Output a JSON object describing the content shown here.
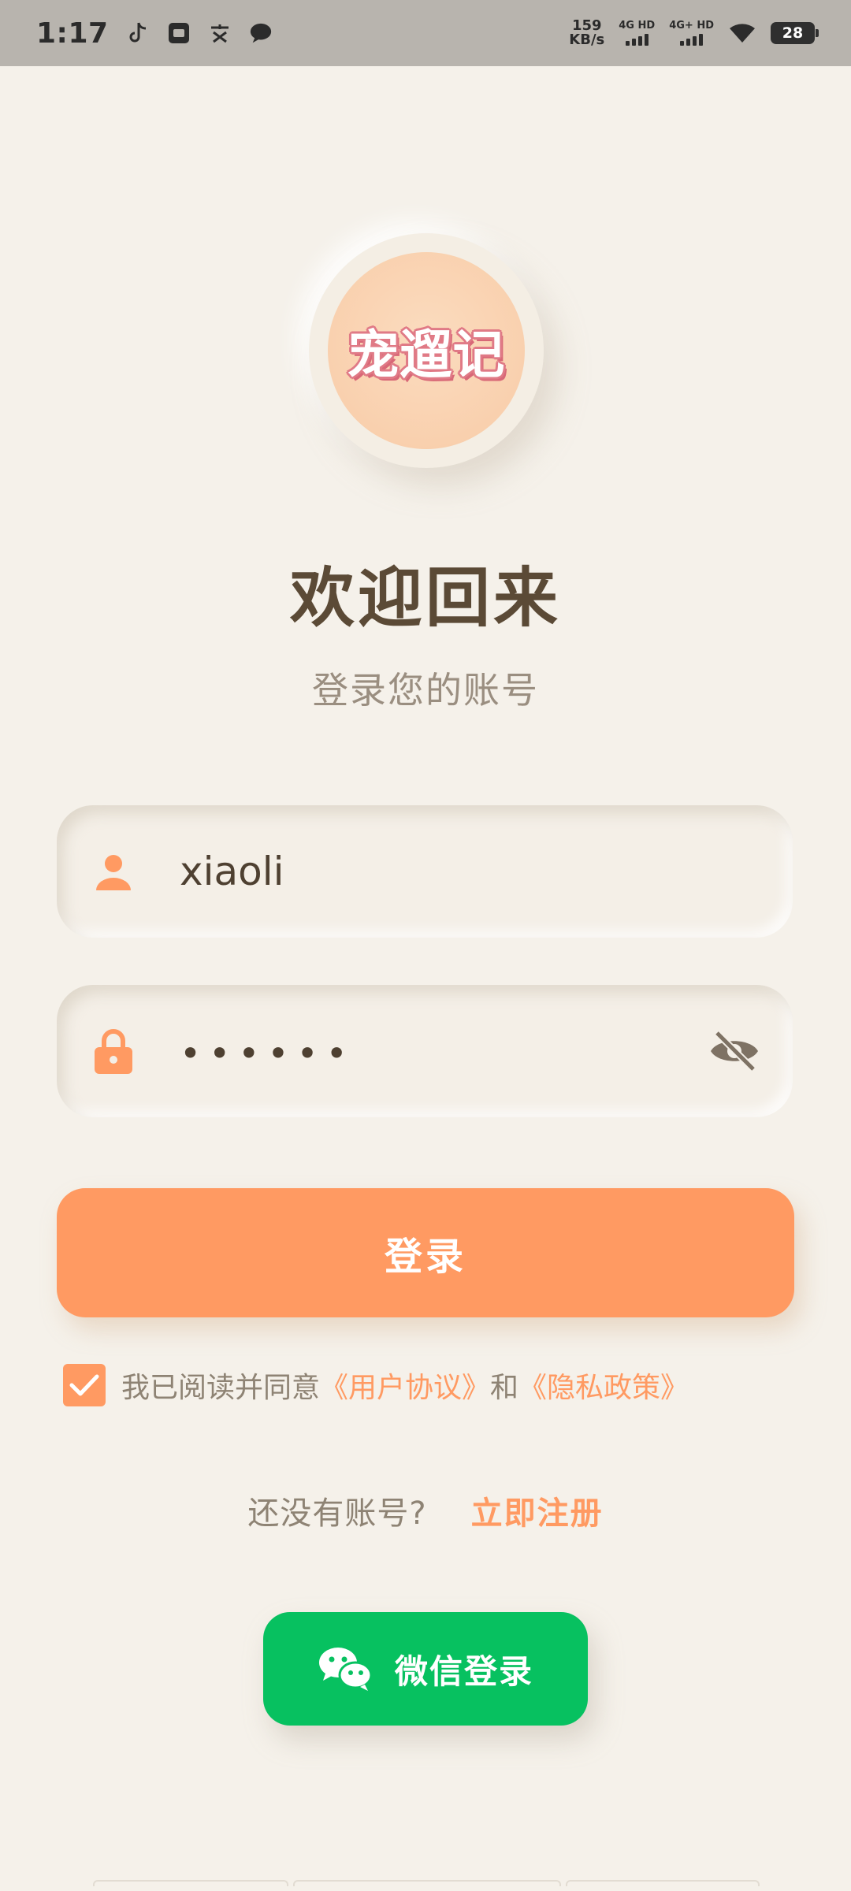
{
  "status_bar": {
    "time": "1:17",
    "speed_value": "159",
    "speed_unit": "KB/s",
    "net1": "4G HD",
    "net2": "4G+ HD",
    "battery": "28",
    "notification_icons": [
      "tiktok-icon",
      "box-icon",
      "text-icon",
      "chat-bubble-icon"
    ]
  },
  "logo": {
    "text": "宠遛记"
  },
  "title": "欢迎回来",
  "subtitle": "登录您的账号",
  "form": {
    "username": "xiaoli",
    "password_masked": "••••••",
    "login_label": "登录"
  },
  "agreement": {
    "prefix": "我已阅读并同意",
    "user_agreement": "《用户协议》",
    "and": "和",
    "privacy_policy": "《隐私政策》",
    "checked": true
  },
  "register": {
    "question": "还没有账号?",
    "link": "立即注册"
  },
  "wechat": {
    "label": "微信登录"
  },
  "colors": {
    "background": "#F5F1EA",
    "accent": "#FF9A62",
    "title": "#5B4A36",
    "wechat": "#07C160"
  }
}
